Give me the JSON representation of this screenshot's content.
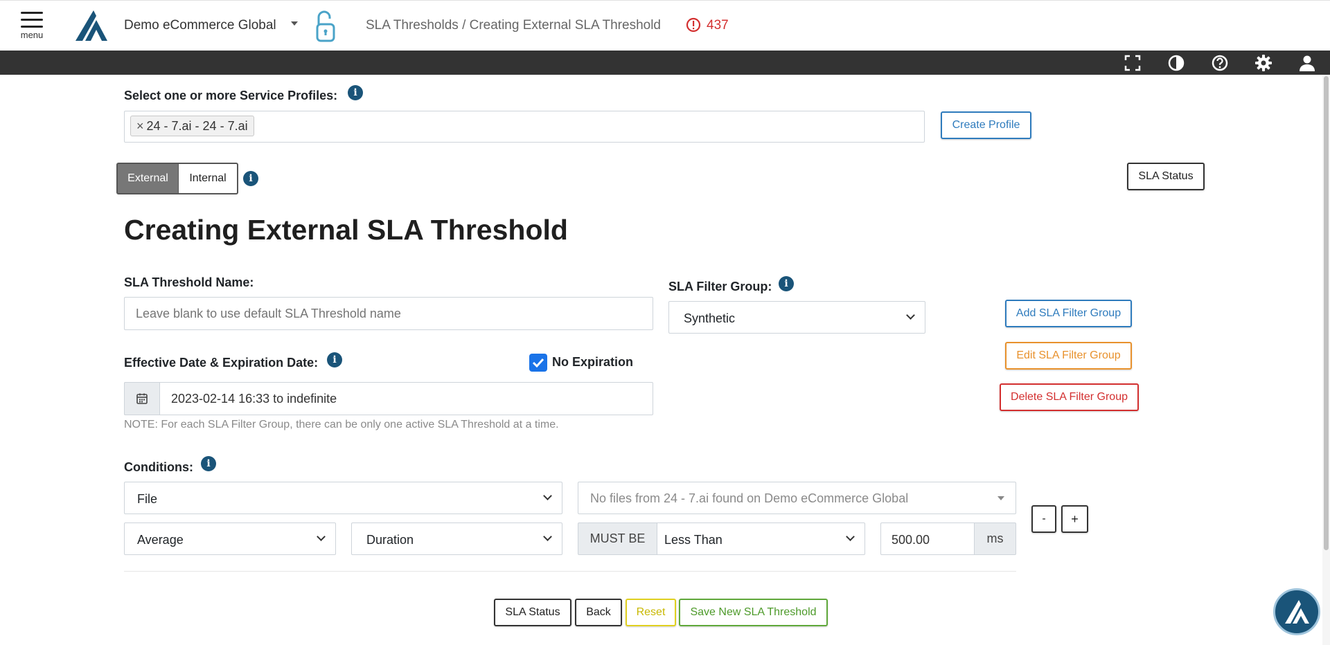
{
  "header": {
    "menu_label": "menu",
    "org_name": "Demo eCommerce Global",
    "breadcrumb": "SLA Thresholds / Creating External SLA Threshold",
    "alert_count": "437"
  },
  "toolbar": {
    "icons": [
      "fullscreen-icon",
      "contrast-icon",
      "help-icon",
      "settings-icon",
      "user-icon"
    ]
  },
  "profiles": {
    "label": "Select one or more Service Profiles:",
    "selected_tag": "24 - 7.ai - 24 - 7.ai",
    "tag_remove": "×",
    "create_button": "Create Profile"
  },
  "toggle": {
    "external": "External",
    "internal": "Internal",
    "active": "External"
  },
  "sla_status_top": "SLA Status",
  "page_title": "Creating External SLA Threshold",
  "threshold_name": {
    "label": "SLA Threshold Name:",
    "placeholder": "Leave blank to use default SLA Threshold name",
    "value": ""
  },
  "filter_group": {
    "label": "SLA Filter Group:",
    "selected": "Synthetic",
    "add_button": "Add SLA Filter Group",
    "edit_button": "Edit SLA Filter Group",
    "delete_button": "Delete SLA Filter Group"
  },
  "dates": {
    "label": "Effective Date & Expiration Date:",
    "no_expiration_label": "No Expiration",
    "no_expiration_checked": true,
    "value": "2023-02-14 16:33 to indefinite",
    "note": "NOTE: For each SLA Filter Group, there can be only one active SLA Threshold at a time."
  },
  "conditions": {
    "label": "Conditions:",
    "type_select": "File",
    "file_select_placeholder": "No files from 24 - 7.ai found on Demo eCommerce Global",
    "aggregate_select": "Average",
    "metric_select": "Duration",
    "must_be_label": "MUST BE",
    "operator_select": "Less Than",
    "value": "500.00",
    "unit": "ms",
    "remove_button": "-",
    "add_button": "+"
  },
  "footer_buttons": {
    "sla_status": "SLA Status",
    "back": "Back",
    "reset": "Reset",
    "save": "Save New SLA Threshold"
  },
  "colors": {
    "brand_navy": "#1a5479",
    "primary_blue": "#2e7bbd",
    "warning_orange": "#e8912c",
    "danger_red": "#d32f2f",
    "success_green": "#5fa83a",
    "reset_yellow": "#e0d020",
    "toolbar_dark": "#333333",
    "alert_red": "#d32f2f"
  }
}
